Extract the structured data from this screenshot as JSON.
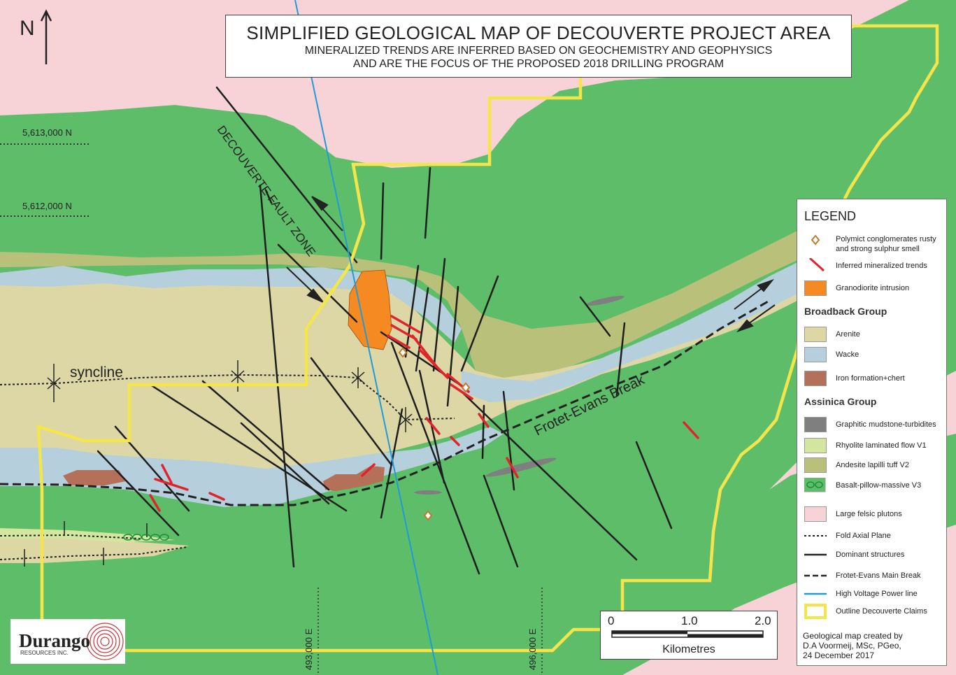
{
  "title": {
    "main": "SIMPLIFIED GEOLOGICAL MAP OF DECOUVERTE PROJECT AREA",
    "line2": "MINERALIZED TRENDS ARE INFERRED BASED ON GEOCHEMISTRY AND GEOPHYSICS",
    "line3": "AND ARE THE FOCUS OF THE PROPOSED 2018 DRILLING PROGRAM"
  },
  "north": "N",
  "grid": {
    "northing_1": "5,613,000 N",
    "northing_2": "5,612,000 N",
    "easting_1": "493,000 E",
    "easting_2": "496,000 E"
  },
  "map_labels": {
    "fault_zone": "DECOUVERTE FAULT ZONE",
    "syncline": "syncline",
    "break": "Frotet-Evans Break"
  },
  "legend": {
    "title": "LEGEND",
    "items_top": [
      {
        "label": "Polymict conglomerates rusty and strong sulphur smell",
        "symbol": "diamond-icon"
      },
      {
        "label": "Inferred mineralized trends",
        "symbol": "red-line-icon"
      },
      {
        "label": "Granodiorite intrusion",
        "color": "#f58a22"
      }
    ],
    "group1": "Broadback Group",
    "items_g1": [
      {
        "label": "Arenite",
        "color": "#dcd7a5"
      },
      {
        "label": "Wacke",
        "color": "#b5cfdc"
      },
      {
        "label": "Iron formation+chert",
        "color": "#b47058"
      }
    ],
    "group2": "Assinica Group",
    "items_g2": [
      {
        "label": "Graphitic mudstone-turbidites",
        "color": "#7f7f80"
      },
      {
        "label": "Rhyolite laminated flow V1",
        "color": "#d3e6a0"
      },
      {
        "label": "Andesite lapilli tuff V2",
        "color": "#b8c07a"
      },
      {
        "label": "Basalt-pillow-massive V3",
        "color": "#5dbd68"
      }
    ],
    "items_other": [
      {
        "label": "Large felsic plutons",
        "color": "#f7d3d7"
      },
      {
        "label": "Fold Axial Plane",
        "symbol": "dotted-line-icon"
      },
      {
        "label": "Dominant structures",
        "symbol": "solid-line-icon"
      },
      {
        "label": "Frotet-Evans Main Break",
        "symbol": "dashed-line-icon"
      },
      {
        "label": "High Voltage Power line",
        "symbol": "blue-line-icon"
      },
      {
        "label": "Outline Decouverte Claims",
        "symbol": "yellow-box-icon"
      }
    ]
  },
  "scale": {
    "ticks": [
      "0",
      "1.0",
      "2.0"
    ],
    "unit": "Kilometres"
  },
  "credit": {
    "line1": "Geological map created by",
    "line2": "D.A Voormeij, MSc, PGeo,",
    "line3": "24 December 2017"
  },
  "logo": {
    "name": "Durango",
    "sub": "RESOURCES INC."
  },
  "colors": {
    "basalt": "#5dbd68",
    "pluton": "#f7d3d7",
    "arenite": "#dcd7a5",
    "wacke": "#b5cfdc",
    "andesite": "#b8c07a",
    "granodiorite": "#f58a22",
    "iron": "#b47058",
    "claims": "#f4e64a",
    "powerline": "#1f9bd7",
    "trend": "#e0242c"
  }
}
